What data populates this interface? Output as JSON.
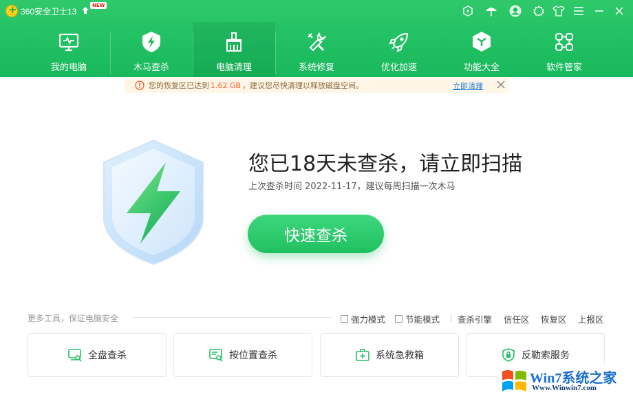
{
  "titlebar": {
    "app_name": "360安全卫士13",
    "new_badge": "NEW"
  },
  "nav": [
    {
      "label": "我的电脑",
      "icon": "monitor-icon"
    },
    {
      "label": "木马查杀",
      "icon": "shield-bolt-icon"
    },
    {
      "label": "电脑清理",
      "icon": "broom-icon",
      "active": true
    },
    {
      "label": "系统修复",
      "icon": "wrench-icon"
    },
    {
      "label": "优化加速",
      "icon": "rocket-icon"
    },
    {
      "label": "功能大全",
      "icon": "cube-icon"
    },
    {
      "label": "软件管家",
      "icon": "apps-icon"
    }
  ],
  "notice": {
    "prefix": "您的恢复区已达到",
    "value": "1.62 GB",
    "suffix": "，建议您尽快清理以释放磁盘空间。",
    "link": "立即清理"
  },
  "hero": {
    "title": "您已18天未查杀，请立即扫描",
    "subtitle": "上次查杀时间 2022-11-17，建议每周扫描一次木马",
    "button": "快速查杀"
  },
  "tools": {
    "label": "更多工具，保证电脑安全",
    "options": [
      "强力模式",
      "节能模式"
    ],
    "links": [
      "查杀引擎",
      "信任区",
      "恢复区",
      "上报区"
    ],
    "cards": [
      "全盘查杀",
      "按位置查杀",
      "系统急救箱",
      "反勒索服务"
    ]
  },
  "watermark": {
    "brand": "Win7系统之家",
    "url": "Www.Winwin7.com"
  },
  "colors": {
    "brand_green": "#1fbf62",
    "notice_bg": "#fff6e8",
    "notice_value": "#ff5a1f",
    "link_blue": "#1a7bd9"
  }
}
